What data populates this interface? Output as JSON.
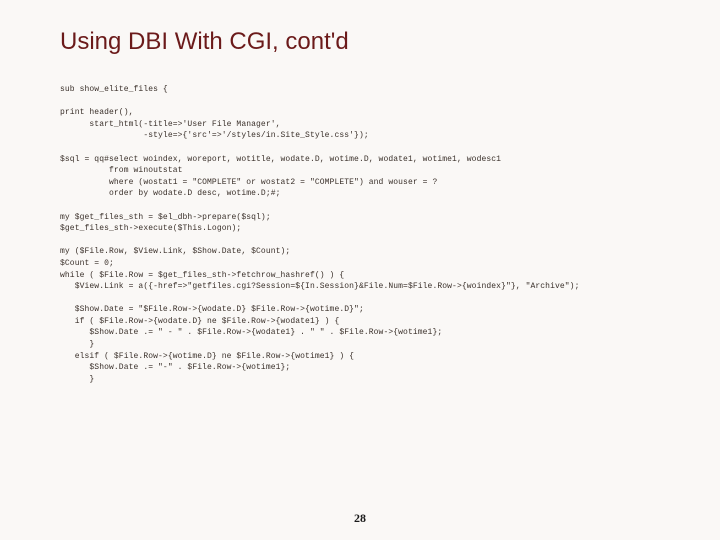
{
  "title": "Using DBI With CGI, cont'd",
  "page_number": "28",
  "code": "sub show_elite_files {\n\nprint header(),\n      start_html(-title=>'User File Manager',\n                 -style=>{'src'=>'/styles/in.Site_Style.css'});\n\n$sql = qq#select woindex, woreport, wotitle, wodate.D, wotime.D, wodate1, wotime1, wodesc1\n          from winoutstat\n          where (wostat1 = \"COMPLETE\" or wostat2 = \"COMPLETE\") and wouser = ?\n          order by wodate.D desc, wotime.D;#;\n\nmy $get_files_sth = $el_dbh->prepare($sql);\n$get_files_sth->execute($This.Logon);\n\nmy ($File.Row, $View.Link, $Show.Date, $Count);\n$Count = 0;\nwhile ( $File.Row = $get_files_sth->fetchrow_hashref() ) {\n   $View.Link = a({-href=>\"getfiles.cgi?Session=${In.Session}&File.Num=$File.Row->{woindex}\"}, \"Archive\");\n\n   $Show.Date = \"$File.Row->{wodate.D} $File.Row->{wotime.D}\";\n   if ( $File.Row->{wodate.D} ne $File.Row->{wodate1} ) {\n      $Show.Date .= \" - \" . $File.Row->{wodate1} . \" \" . $File.Row->{wotime1};\n      }\n   elsif ( $File.Row->{wotime.D} ne $File.Row->{wotime1} ) {\n      $Show.Date .= \"-\" . $File.Row->{wotime1};\n      }"
}
